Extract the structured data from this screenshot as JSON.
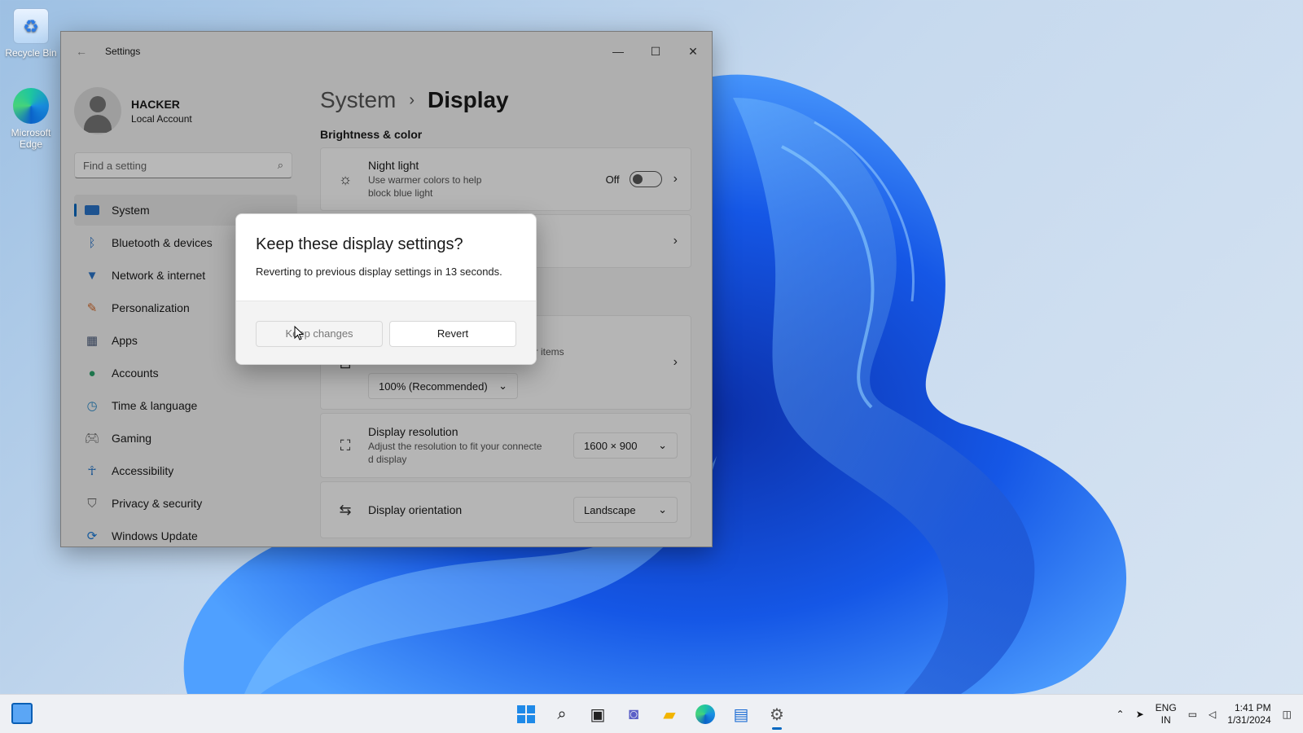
{
  "desktop": {
    "recycle_bin": "Recycle Bin",
    "edge": "Microsoft Edge"
  },
  "window": {
    "title": "Settings",
    "minimize": "—",
    "maximize": "☐",
    "close": "✕"
  },
  "profile": {
    "name": "HACKER",
    "account_type": "Local Account"
  },
  "search": {
    "placeholder": "Find a setting"
  },
  "nav": {
    "items": [
      {
        "label": "System",
        "icon": "display-icon"
      },
      {
        "label": "Bluetooth & devices",
        "icon": "bluetooth-icon"
      },
      {
        "label": "Network & internet",
        "icon": "wifi-icon"
      },
      {
        "label": "Personalization",
        "icon": "brush-icon"
      },
      {
        "label": "Apps",
        "icon": "apps-icon"
      },
      {
        "label": "Accounts",
        "icon": "person-icon"
      },
      {
        "label": "Time & language",
        "icon": "globe-clock-icon"
      },
      {
        "label": "Gaming",
        "icon": "gamepad-icon"
      },
      {
        "label": "Accessibility",
        "icon": "accessibility-icon"
      },
      {
        "label": "Privacy & security",
        "icon": "shield-icon"
      },
      {
        "label": "Windows Update",
        "icon": "update-icon"
      }
    ]
  },
  "content": {
    "breadcrumb_parent": "System",
    "breadcrumb_current": "Display",
    "section_brightness": "Brightness & color",
    "night_light": {
      "title": "Night light",
      "desc_line1": "Use warmer colors to help",
      "desc_line2": "block blue light",
      "state": "Off"
    },
    "scale": {
      "desc_fragment": "her items",
      "value": "100% (Recommended)"
    },
    "resolution": {
      "title": "Display resolution",
      "desc_line1": "Adjust the resolution to fit your connecte",
      "desc_line2": "d display",
      "value": "1600 × 900"
    },
    "orientation": {
      "title": "Display orientation",
      "value": "Landscape"
    }
  },
  "dialog": {
    "title": "Keep these display settings?",
    "message": "Reverting to previous display settings in 13 seconds.",
    "keep_label": "Keep changes",
    "revert_label": "Revert"
  },
  "tray": {
    "lang_line1": "ENG",
    "lang_line2": "IN",
    "time": "1:41 PM",
    "date": "1/31/2024"
  },
  "colors": {
    "accent": "#0067c0",
    "wallpaper_blue": "#1450d8"
  }
}
